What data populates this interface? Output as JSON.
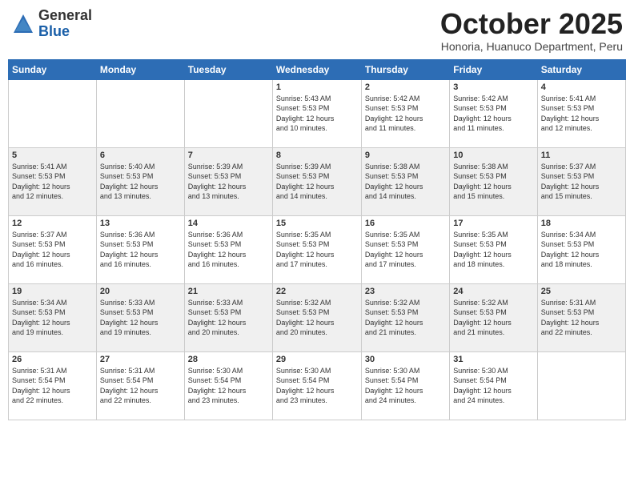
{
  "header": {
    "logo": {
      "general": "General",
      "blue": "Blue"
    },
    "title": "October 2025",
    "subtitle": "Honoria, Huanuco Department, Peru"
  },
  "days_of_week": [
    "Sunday",
    "Monday",
    "Tuesday",
    "Wednesday",
    "Thursday",
    "Friday",
    "Saturday"
  ],
  "weeks": [
    [
      {
        "day": "",
        "info": ""
      },
      {
        "day": "",
        "info": ""
      },
      {
        "day": "",
        "info": ""
      },
      {
        "day": "1",
        "info": "Sunrise: 5:43 AM\nSunset: 5:53 PM\nDaylight: 12 hours\nand 10 minutes."
      },
      {
        "day": "2",
        "info": "Sunrise: 5:42 AM\nSunset: 5:53 PM\nDaylight: 12 hours\nand 11 minutes."
      },
      {
        "day": "3",
        "info": "Sunrise: 5:42 AM\nSunset: 5:53 PM\nDaylight: 12 hours\nand 11 minutes."
      },
      {
        "day": "4",
        "info": "Sunrise: 5:41 AM\nSunset: 5:53 PM\nDaylight: 12 hours\nand 12 minutes."
      }
    ],
    [
      {
        "day": "5",
        "info": "Sunrise: 5:41 AM\nSunset: 5:53 PM\nDaylight: 12 hours\nand 12 minutes."
      },
      {
        "day": "6",
        "info": "Sunrise: 5:40 AM\nSunset: 5:53 PM\nDaylight: 12 hours\nand 13 minutes."
      },
      {
        "day": "7",
        "info": "Sunrise: 5:39 AM\nSunset: 5:53 PM\nDaylight: 12 hours\nand 13 minutes."
      },
      {
        "day": "8",
        "info": "Sunrise: 5:39 AM\nSunset: 5:53 PM\nDaylight: 12 hours\nand 14 minutes."
      },
      {
        "day": "9",
        "info": "Sunrise: 5:38 AM\nSunset: 5:53 PM\nDaylight: 12 hours\nand 14 minutes."
      },
      {
        "day": "10",
        "info": "Sunrise: 5:38 AM\nSunset: 5:53 PM\nDaylight: 12 hours\nand 15 minutes."
      },
      {
        "day": "11",
        "info": "Sunrise: 5:37 AM\nSunset: 5:53 PM\nDaylight: 12 hours\nand 15 minutes."
      }
    ],
    [
      {
        "day": "12",
        "info": "Sunrise: 5:37 AM\nSunset: 5:53 PM\nDaylight: 12 hours\nand 16 minutes."
      },
      {
        "day": "13",
        "info": "Sunrise: 5:36 AM\nSunset: 5:53 PM\nDaylight: 12 hours\nand 16 minutes."
      },
      {
        "day": "14",
        "info": "Sunrise: 5:36 AM\nSunset: 5:53 PM\nDaylight: 12 hours\nand 16 minutes."
      },
      {
        "day": "15",
        "info": "Sunrise: 5:35 AM\nSunset: 5:53 PM\nDaylight: 12 hours\nand 17 minutes."
      },
      {
        "day": "16",
        "info": "Sunrise: 5:35 AM\nSunset: 5:53 PM\nDaylight: 12 hours\nand 17 minutes."
      },
      {
        "day": "17",
        "info": "Sunrise: 5:35 AM\nSunset: 5:53 PM\nDaylight: 12 hours\nand 18 minutes."
      },
      {
        "day": "18",
        "info": "Sunrise: 5:34 AM\nSunset: 5:53 PM\nDaylight: 12 hours\nand 18 minutes."
      }
    ],
    [
      {
        "day": "19",
        "info": "Sunrise: 5:34 AM\nSunset: 5:53 PM\nDaylight: 12 hours\nand 19 minutes."
      },
      {
        "day": "20",
        "info": "Sunrise: 5:33 AM\nSunset: 5:53 PM\nDaylight: 12 hours\nand 19 minutes."
      },
      {
        "day": "21",
        "info": "Sunrise: 5:33 AM\nSunset: 5:53 PM\nDaylight: 12 hours\nand 20 minutes."
      },
      {
        "day": "22",
        "info": "Sunrise: 5:32 AM\nSunset: 5:53 PM\nDaylight: 12 hours\nand 20 minutes."
      },
      {
        "day": "23",
        "info": "Sunrise: 5:32 AM\nSunset: 5:53 PM\nDaylight: 12 hours\nand 21 minutes."
      },
      {
        "day": "24",
        "info": "Sunrise: 5:32 AM\nSunset: 5:53 PM\nDaylight: 12 hours\nand 21 minutes."
      },
      {
        "day": "25",
        "info": "Sunrise: 5:31 AM\nSunset: 5:53 PM\nDaylight: 12 hours\nand 22 minutes."
      }
    ],
    [
      {
        "day": "26",
        "info": "Sunrise: 5:31 AM\nSunset: 5:54 PM\nDaylight: 12 hours\nand 22 minutes."
      },
      {
        "day": "27",
        "info": "Sunrise: 5:31 AM\nSunset: 5:54 PM\nDaylight: 12 hours\nand 22 minutes."
      },
      {
        "day": "28",
        "info": "Sunrise: 5:30 AM\nSunset: 5:54 PM\nDaylight: 12 hours\nand 23 minutes."
      },
      {
        "day": "29",
        "info": "Sunrise: 5:30 AM\nSunset: 5:54 PM\nDaylight: 12 hours\nand 23 minutes."
      },
      {
        "day": "30",
        "info": "Sunrise: 5:30 AM\nSunset: 5:54 PM\nDaylight: 12 hours\nand 24 minutes."
      },
      {
        "day": "31",
        "info": "Sunrise: 5:30 AM\nSunset: 5:54 PM\nDaylight: 12 hours\nand 24 minutes."
      },
      {
        "day": "",
        "info": ""
      }
    ]
  ]
}
